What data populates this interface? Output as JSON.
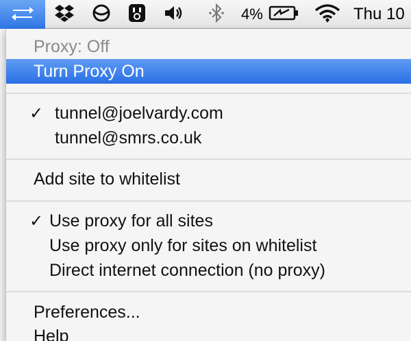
{
  "menubar": {
    "icons": {
      "proxy": "proxy-arrows-icon",
      "dropbox": "dropbox-icon",
      "circle": "circle-slash-icon",
      "app": "app-face-icon",
      "volume": "volume-icon",
      "bluetooth": "bluetooth-icon",
      "battery": "battery-charging-icon",
      "wifi": "wifi-icon"
    },
    "battery_percent": "4%",
    "clock": "Thu 10"
  },
  "menu": {
    "status": "Proxy: Off",
    "toggle": "Turn Proxy On",
    "accounts": [
      {
        "label": "tunnel@joelvardy.com",
        "checked": true
      },
      {
        "label": "tunnel@smrs.co.uk",
        "checked": false
      }
    ],
    "add_whitelist": "Add site to whitelist",
    "modes": [
      {
        "label": "Use proxy for all sites",
        "checked": true
      },
      {
        "label": "Use proxy only for sites on whitelist",
        "checked": false
      },
      {
        "label": "Direct internet connection (no proxy)",
        "checked": false
      }
    ],
    "preferences": "Preferences...",
    "help": "Help",
    "check_glyph": "✓"
  },
  "colors": {
    "highlight": "#2f76e6",
    "disabled_text": "#8a8a8a"
  }
}
